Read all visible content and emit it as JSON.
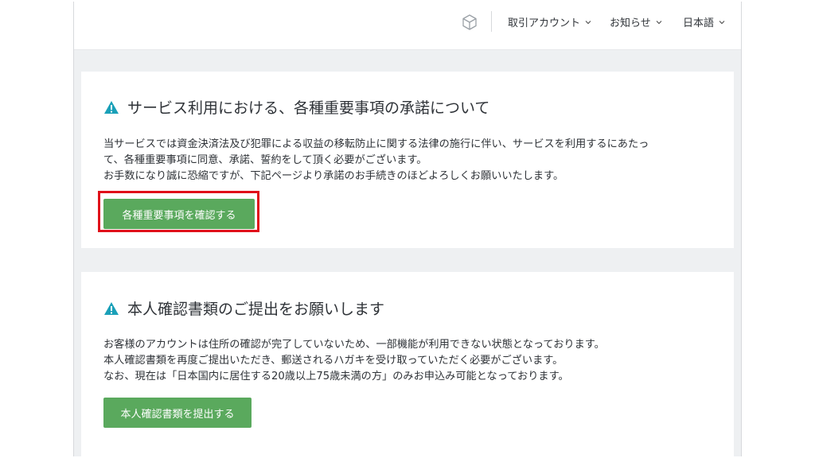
{
  "header": {
    "account_label": "取引アカウント",
    "notice_label": "お知らせ",
    "language_label": "日本語"
  },
  "sections": [
    {
      "title": "サービス利用における、各種重要事項の承諾について",
      "body_lines": [
        "当サービスでは資金決済法及び犯罪による収益の移転防止に関する法律の施行に伴い、サービスを利用するにあたっ",
        "て、各種重要事項に同意、承諾、誓約をして頂く必要がございます。",
        "お手数になり誠に恐縮ですが、下記ページより承諾のお手続きのほどよろしくお願いいたします。"
      ],
      "button_label": "各種重要事項を確認する"
    },
    {
      "title": "本人確認書類のご提出をお願いします",
      "body_lines": [
        "お客様のアカウントは住所の確認が完了していないため、一部機能が利用できない状態となっております。",
        "本人確認書類を再度ご提出いただき、郵送されるハガキを受け取っていただく必要がございます。",
        "なお、現在は「日本国内に居住する20歳以上75歳未満の方」のみお申込み可能となっております。"
      ],
      "button_label": "本人確認書類を提出する"
    }
  ],
  "colors": {
    "accent_green": "#5aa95d",
    "warning_teal": "#1aa0b8",
    "highlight_red": "#e0101a"
  }
}
